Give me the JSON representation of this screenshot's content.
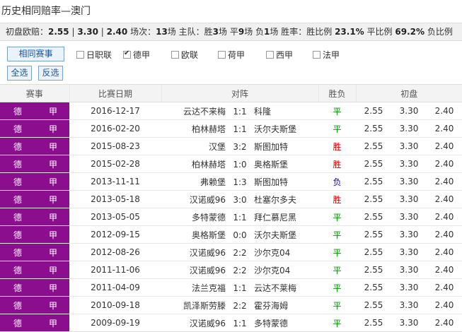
{
  "title": "历史相同赔率—澳门",
  "summary": {
    "odds_label": "初盘欧赔：",
    "odds_home": "2.55",
    "odds_draw": "3.30",
    "odds_away": "2.40",
    "sep": "|",
    "matches_label": "场次：",
    "matches": "13",
    "matches_unit": "场",
    "home_label": "主队：胜",
    "wins": "3",
    "field_unit_win": "场 平",
    "draws": "9",
    "field_unit_draw": "场 负",
    "losses": "1",
    "field_unit_loss": "场",
    "winrate_label": "胜率：胜比例",
    "winrate": "23.1%",
    "drawrate_label": "平比例",
    "drawrate": "69.2%",
    "lossrate_label": "负比例"
  },
  "filters": {
    "same_event_btn": "相同赛事",
    "select_all_btn": "全选",
    "invert_btn": "反选",
    "leagues": [
      {
        "label": "日职联",
        "checked": false
      },
      {
        "label": "德甲",
        "checked": true
      },
      {
        "label": "欧联",
        "checked": false
      },
      {
        "label": "荷甲",
        "checked": false
      },
      {
        "label": "西甲",
        "checked": false
      },
      {
        "label": "法甲",
        "checked": false
      }
    ]
  },
  "table": {
    "headers": [
      "赛事",
      "比赛日期",
      "对阵",
      "胜负",
      "初盘"
    ],
    "rows": [
      {
        "league_a": "德",
        "league_b": "甲",
        "date": "2016-12-17",
        "home": "云达不来梅",
        "score": "1:1",
        "away": "科隆",
        "result": "平",
        "o1": "2.55",
        "o2": "3.30",
        "o3": "2.40"
      },
      {
        "league_a": "德",
        "league_b": "甲",
        "date": "2016-02-20",
        "home": "柏林赫塔",
        "score": "1:1",
        "away": "沃尔夫斯堡",
        "result": "平",
        "o1": "2.55",
        "o2": "3.30",
        "o3": "2.40"
      },
      {
        "league_a": "德",
        "league_b": "甲",
        "date": "2015-08-23",
        "home": "汉堡",
        "score": "3:2",
        "away": "斯图加特",
        "result": "胜",
        "o1": "2.55",
        "o2": "3.30",
        "o3": "2.40"
      },
      {
        "league_a": "德",
        "league_b": "甲",
        "date": "2015-02-28",
        "home": "柏林赫塔",
        "score": "1:0",
        "away": "奥格斯堡",
        "result": "胜",
        "o1": "2.55",
        "o2": "3.30",
        "o3": "2.40"
      },
      {
        "league_a": "德",
        "league_b": "甲",
        "date": "2013-11-11",
        "home": "弗赖堡",
        "score": "1:3",
        "away": "斯图加特",
        "result": "负",
        "o1": "2.55",
        "o2": "3.30",
        "o3": "2.40"
      },
      {
        "league_a": "德",
        "league_b": "甲",
        "date": "2013-05-18",
        "home": "汉诺威96",
        "score": "3:0",
        "away": "杜塞尔多夫",
        "result": "胜",
        "o1": "2.55",
        "o2": "3.30",
        "o3": "2.40"
      },
      {
        "league_a": "德",
        "league_b": "甲",
        "date": "2013-05-05",
        "home": "多特蒙德",
        "score": "1:1",
        "away": "拜仁慕尼黑",
        "result": "平",
        "o1": "2.55",
        "o2": "3.30",
        "o3": "2.40"
      },
      {
        "league_a": "德",
        "league_b": "甲",
        "date": "2012-09-15",
        "home": "奥格斯堡",
        "score": "0:0",
        "away": "沃尔夫斯堡",
        "result": "平",
        "o1": "2.55",
        "o2": "3.30",
        "o3": "2.40"
      },
      {
        "league_a": "德",
        "league_b": "甲",
        "date": "2012-08-26",
        "home": "汉诺威96",
        "score": "2:2",
        "away": "沙尔克04",
        "result": "平",
        "o1": "2.55",
        "o2": "3.30",
        "o3": "2.40"
      },
      {
        "league_a": "德",
        "league_b": "甲",
        "date": "2011-11-06",
        "home": "汉诺威96",
        "score": "2:2",
        "away": "沙尔克04",
        "result": "平",
        "o1": "2.55",
        "o2": "3.30",
        "o3": "2.40"
      },
      {
        "league_a": "德",
        "league_b": "甲",
        "date": "2011-04-09",
        "home": "法兰克福",
        "score": "1:1",
        "away": "云达不莱梅",
        "result": "平",
        "o1": "2.55",
        "o2": "3.30",
        "o3": "2.40"
      },
      {
        "league_a": "德",
        "league_b": "甲",
        "date": "2010-09-18",
        "home": "凯泽斯劳滕",
        "score": "2:2",
        "away": "霍芬海姆",
        "result": "平",
        "o1": "2.55",
        "o2": "3.30",
        "o3": "2.40"
      },
      {
        "league_a": "德",
        "league_b": "甲",
        "date": "2009-09-19",
        "home": "汉诺威96",
        "score": "1:1",
        "away": "多特蒙德",
        "result": "平",
        "o1": "2.55",
        "o2": "3.30",
        "o3": "2.40"
      }
    ]
  },
  "colors": {
    "win": "#e00000",
    "draw": "#009900",
    "loss": "#0000ff",
    "league_bg": "#8b0e8f"
  }
}
